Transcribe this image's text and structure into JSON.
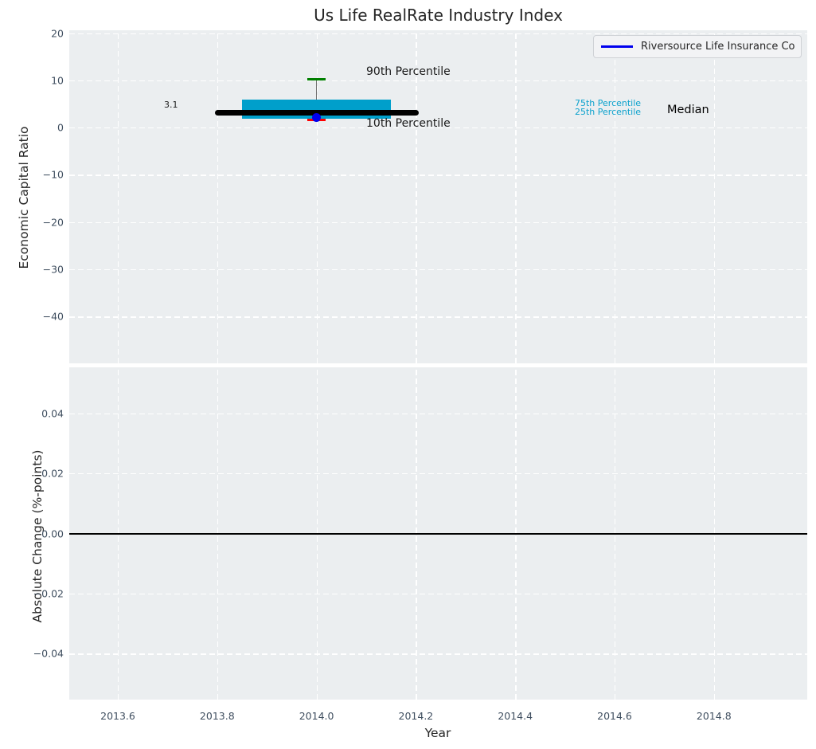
{
  "title": "Us Life RealRate Industry Index",
  "legend": {
    "label": "Riversource Life Insurance Co",
    "line_color": "#0000ee"
  },
  "annotations": {
    "p90": "90th Percentile",
    "p10": "10th Percentile",
    "p75": "75th Percentile",
    "p25": "25th Percentile",
    "median": "Median",
    "median_value_label": "3.1"
  },
  "colors": {
    "plot_background": "#ebeef0",
    "grid": "#ffffff",
    "box_fill": "#009fcb",
    "median_line": "#000000",
    "p90_cap": "#007f00",
    "p10_cap": "#ff0000",
    "company_point": "#0000ee",
    "whisker": "#6f6f6f",
    "tick_text": "#3f4e5f"
  },
  "chart_data": [
    {
      "type": "box",
      "title": "Us Life RealRate Industry Index",
      "xlabel": "Year",
      "ylabel": "Economic Capital Ratio",
      "xlim": [
        2013.5,
        2014.99
      ],
      "ylim": [
        -49.5,
        20.6
      ],
      "xticks": [
        "2013.6",
        "2013.8",
        "2014.0",
        "2014.2",
        "2014.4",
        "2014.6",
        "2014.8"
      ],
      "xtick_values": [
        2013.6,
        2013.8,
        2014.0,
        2014.2,
        2014.4,
        2014.6,
        2014.8
      ],
      "yticks": [
        "20",
        "10",
        "0",
        "−10",
        "−20",
        "−30",
        "−40"
      ],
      "ytick_values": [
        20,
        10,
        0,
        -10,
        -20,
        -30,
        -40
      ],
      "grid": true,
      "legend_position": "upper right",
      "box": {
        "x": 2014.0,
        "p90": 10.2,
        "p75": 6.0,
        "median": 3.1,
        "p25": 1.9,
        "p10": 1.6,
        "box_width_years": 0.3,
        "median_line_width_years": 0.41,
        "cap_width_years": 0.036
      },
      "series": [
        {
          "name": "Riversource Life Insurance Co",
          "x": [
            2014.0
          ],
          "values": [
            2.2
          ],
          "marker": "dot"
        }
      ]
    },
    {
      "type": "line",
      "xlabel": "Year",
      "ylabel": "Absolute Change (%-points)",
      "xlim": [
        2013.5,
        2014.99
      ],
      "ylim": [
        -0.055,
        0.055
      ],
      "yticks": [
        "0.04",
        "0.02",
        "0.00",
        "−0.02",
        "−0.04"
      ],
      "ytick_values": [
        0.04,
        0.02,
        0.0,
        -0.02,
        -0.04
      ],
      "grid": true,
      "zero_line": 0.0,
      "series": []
    }
  ]
}
